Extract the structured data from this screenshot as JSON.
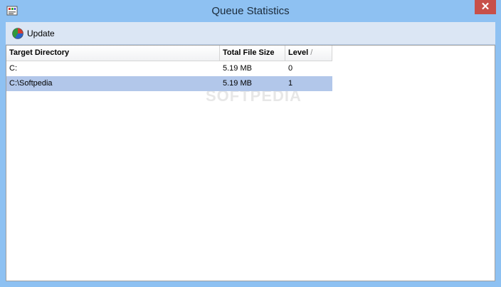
{
  "window": {
    "title": "Queue Statistics",
    "close_label": "✕"
  },
  "toolbar": {
    "update_label": "Update"
  },
  "table": {
    "columns": [
      "Target Directory",
      "Total File Size",
      "Level"
    ],
    "sort_indicator": "/",
    "rows": [
      {
        "directory": "C:",
        "size": "5.19 MB",
        "level": "0"
      },
      {
        "directory": "C:\\Softpedia",
        "size": "5.19 MB",
        "level": "1"
      }
    ],
    "selected_row": 1
  },
  "watermark": "SOFTPEDIA",
  "colors": {
    "frame": "#8ec1f2",
    "selection": "#b2c7ea",
    "close": "#c7504a"
  }
}
